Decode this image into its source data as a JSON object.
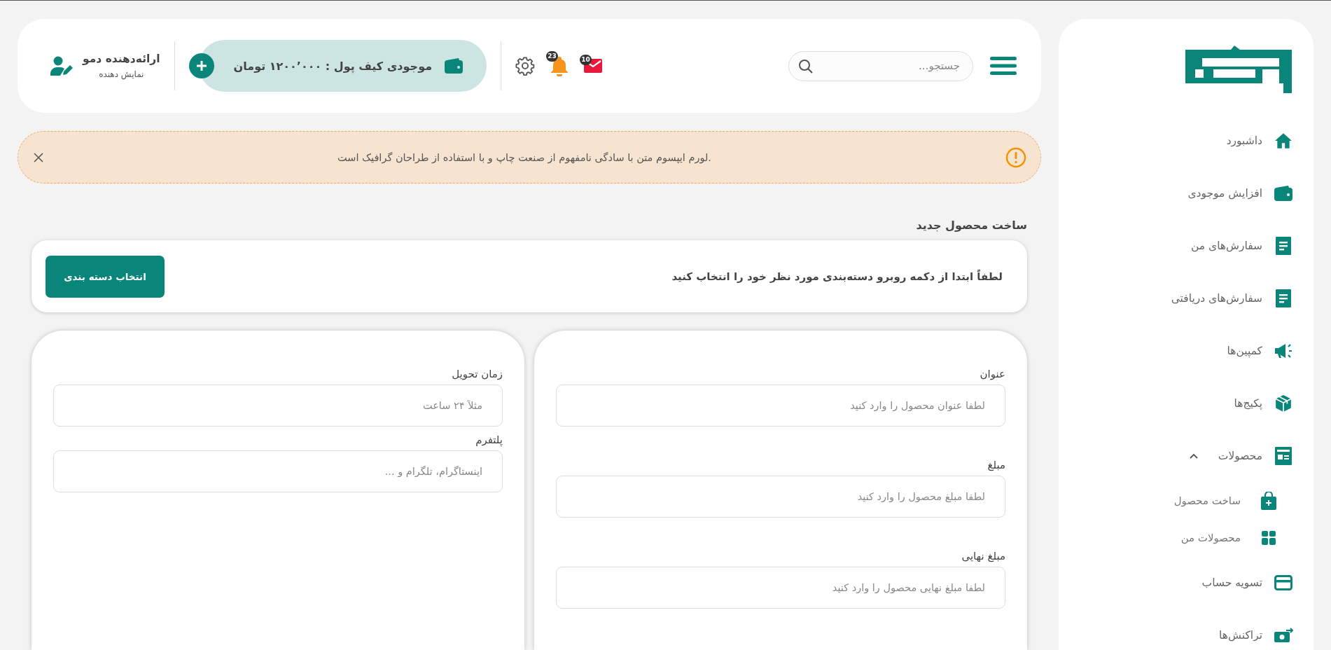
{
  "sidebar": {
    "items": [
      {
        "label": "داشبورد"
      },
      {
        "label": "افزایش موجودی"
      },
      {
        "label": "سفارش‌های من"
      },
      {
        "label": "سفارش‌های دریافتی"
      },
      {
        "label": "کمپین‌ها"
      },
      {
        "label": "پکیج‌ها"
      },
      {
        "label": "محصولات",
        "expanded": true,
        "children": [
          {
            "label": "ساخت محصول"
          },
          {
            "label": "محصولات من"
          }
        ]
      },
      {
        "label": "تسویه حساب"
      },
      {
        "label": "تراکنش‌ها"
      }
    ]
  },
  "header": {
    "search": {
      "placeholder": "جستجو..."
    },
    "mail_badge": "10",
    "bell_badge": "23",
    "wallet": "موجودی کیف پول : ۱۲۰۰٬۰۰۰ تومان",
    "user": {
      "name": "ارائه‌دهنده دمو",
      "role": "نمایش دهنده"
    }
  },
  "alert": {
    "text": ".لورم ایپسوم متن با سادگی نامفهوم از صنعت چاپ و با استفاده از طراحان گرافیک است"
  },
  "page_title": "ساخت محصول جدید",
  "category": {
    "message": "لطفاً ابتدا از دکمه روبرو دسته‌بندی مورد نظر خود را انتخاب کنید",
    "button": "انتخاب دسته بندی"
  },
  "form_cards": [
    {
      "fields": [
        {
          "label": "عنوان",
          "placeholder": "لطفا عنوان محصول را وارد کنید"
        },
        {
          "label": "مبلغ",
          "placeholder": "لطفا مبلغ محصول را وارد کنید"
        },
        {
          "label": "مبلغ نهایی",
          "placeholder": "لطفا مبلغ نهایی محصول را وارد کنید"
        }
      ]
    },
    {
      "fields": [
        {
          "label": "زمان تحویل",
          "placeholder": "مثلاً ۲۴ ساعت"
        },
        {
          "label": "پلتفرم",
          "placeholder": "اینستاگرام، تلگرام و ..."
        }
      ]
    }
  ]
}
